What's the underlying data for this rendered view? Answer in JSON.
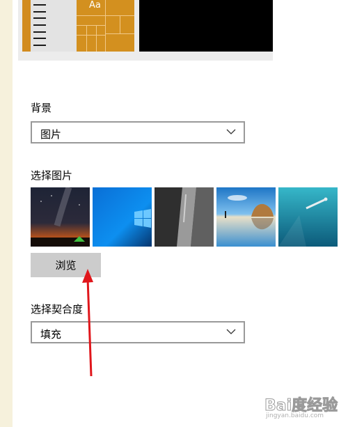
{
  "preview": {
    "tile_text": "Aa"
  },
  "background": {
    "label": "背景",
    "selected": "图片"
  },
  "choose_picture": {
    "label": "选择图片",
    "thumbnails": [
      "milky-way-night-camping",
      "windows-10-blue-logo",
      "granite-cliff-climber",
      "beach-sea-stack-reflection",
      "underwater-swimmer"
    ]
  },
  "browse": {
    "label": "浏览"
  },
  "fit": {
    "label": "选择契合度",
    "selected": "填充"
  },
  "colors": {
    "accent_tile": "#d3901f",
    "arrow": "#e0161b",
    "dropdown_border": "#999999",
    "button_bg": "#cccccc"
  },
  "watermark": {
    "brand": "Bai度经验",
    "url": "jingyan.baidu.com"
  }
}
